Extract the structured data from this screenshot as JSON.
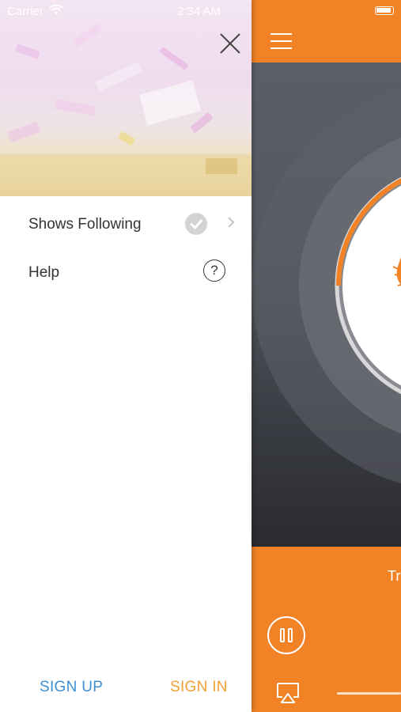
{
  "status_bar": {
    "carrier": "Carrier",
    "time": "2:34 AM"
  },
  "drawer": {
    "menu_items": [
      {
        "label": "Shows Following",
        "icon": "check-circle-icon",
        "trailing_icon": "chevron-right-icon"
      },
      {
        "label": "Help",
        "icon": "question-circle-icon"
      }
    ],
    "sign_up_label": "SIGN UP",
    "sign_in_label": "SIGN IN"
  },
  "player": {
    "track_title_partial": "Tr",
    "accent_color": "#f28226",
    "playback_state": "playing"
  },
  "colors": {
    "sign_up": "#3d8fd6",
    "sign_in": "#f0a133",
    "header": "#f28226"
  }
}
